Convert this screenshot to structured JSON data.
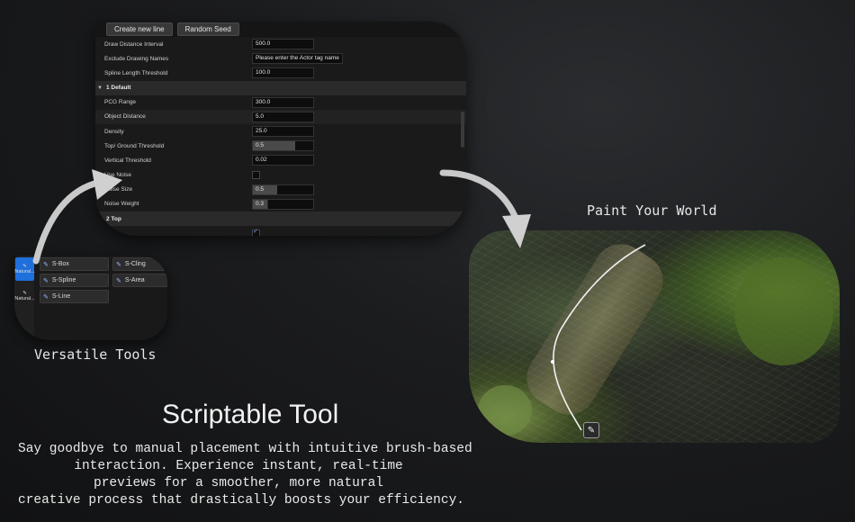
{
  "panel": {
    "buttons": [
      "Create new line",
      "Random Seed"
    ],
    "rows_top": [
      {
        "label": "Draw Distance Interval",
        "value": "500.0"
      },
      {
        "label": "Exclude Drawing Names",
        "value": "Please enter the Actor tag name"
      },
      {
        "label": "Spline Length Threshold",
        "value": "100.0"
      }
    ],
    "section_default": "1 Default",
    "rows_default": [
      {
        "label": "PCG Range",
        "value": "300.0"
      },
      {
        "label": "Object Distance",
        "value": "5.0"
      },
      {
        "label": "Density",
        "value": "25.0"
      },
      {
        "label": "Top/ Ground Threshold",
        "value": "0.5",
        "fill": 0.7
      },
      {
        "label": "Vertical Threshold",
        "value": "0.02"
      },
      {
        "label": "Use Noise",
        "checked": false
      },
      {
        "label": "Noise Size",
        "value": "0.5",
        "fill": 0.4
      },
      {
        "label": "Noise Weight",
        "value": "0.3",
        "fill": 0.25
      }
    ],
    "section_top": "2 Top"
  },
  "tools": {
    "side": [
      {
        "label": "Natural...",
        "icon": "brush-icon",
        "active": true
      },
      {
        "label": "Natural...",
        "icon": "brush-icon",
        "active": false
      }
    ],
    "items": [
      "S-Box",
      "S-Cling",
      "S-Spline",
      "S-Area",
      "S-Line"
    ]
  },
  "captions": {
    "paint": "Paint Your World",
    "versatile": "Versatile Tools"
  },
  "headline": "Scriptable Tool",
  "description": [
    "Say goodbye to manual placement with intuitive brush-based",
    "interaction. Experience instant, real-time",
    "previews for a smoother, more natural",
    "creative process that drastically boosts your efficiency."
  ],
  "colors": {
    "accent": "#1f6fdc",
    "background": "#1b1c1e"
  }
}
